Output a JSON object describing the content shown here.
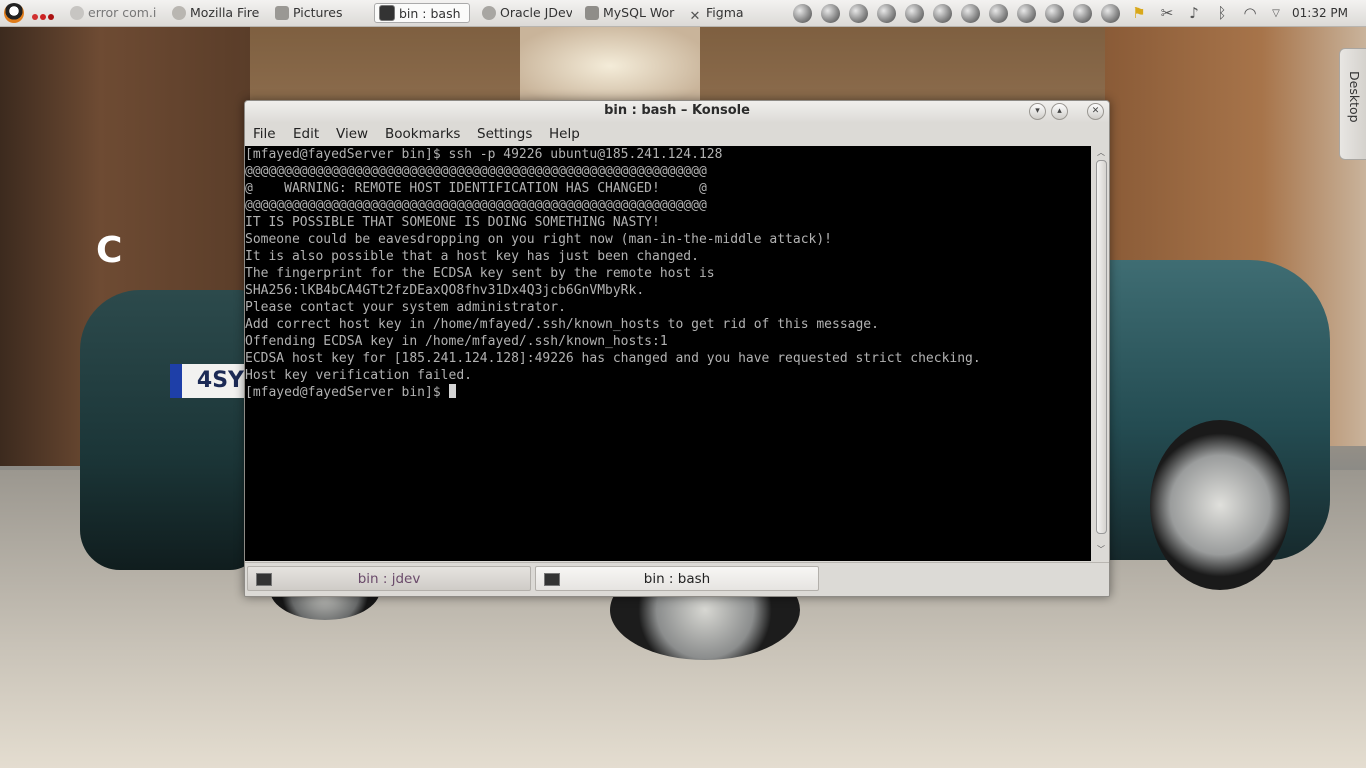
{
  "taskbar": {
    "tasks": [
      {
        "label": "error com.i"
      },
      {
        "label": "Mozilla Fire"
      },
      {
        "label": "Pictures"
      },
      {
        "label": "bin : bash"
      },
      {
        "label": "Oracle JDev"
      },
      {
        "label": "MySQL Wor"
      },
      {
        "label": "Figma"
      }
    ],
    "clock": "01:32 PM",
    "desktop_label": "Desktop"
  },
  "window": {
    "title": "bin : bash – Konsole",
    "menu": [
      "File",
      "Edit",
      "View",
      "Bookmarks",
      "Settings",
      "Help"
    ]
  },
  "terminal": {
    "lines": [
      "[mfayed@fayedServer bin]$ ssh -p 49226 ubuntu@185.241.124.128",
      "@@@@@@@@@@@@@@@@@@@@@@@@@@@@@@@@@@@@@@@@@@@@@@@@@@@@@@@@@@@",
      "@    WARNING: REMOTE HOST IDENTIFICATION HAS CHANGED!     @",
      "@@@@@@@@@@@@@@@@@@@@@@@@@@@@@@@@@@@@@@@@@@@@@@@@@@@@@@@@@@@",
      "IT IS POSSIBLE THAT SOMEONE IS DOING SOMETHING NASTY!",
      "Someone could be eavesdropping on you right now (man-in-the-middle attack)!",
      "It is also possible that a host key has just been changed.",
      "The fingerprint for the ECDSA key sent by the remote host is",
      "SHA256:lKB4bCA4GTt2fzDEaxQO8fhv31Dx4Q3jcb6GnVMbyRk.",
      "Please contact your system administrator.",
      "Add correct host key in /home/mfayed/.ssh/known_hosts to get rid of this message.",
      "Offending ECDSA key in /home/mfayed/.ssh/known_hosts:1",
      "ECDSA host key for [185.241.124.128]:49226 has changed and you have requested strict checking.",
      "Host key verification failed."
    ],
    "prompt": "[mfayed@fayedServer bin]$ "
  },
  "tabs": [
    {
      "label": "bin : jdev",
      "active": false
    },
    {
      "label": "bin : bash",
      "active": true
    }
  ],
  "wallpaper": {
    "plate_text": "4SY",
    "building_letter": "C"
  },
  "colors": {
    "terminal_bg": "#000000",
    "terminal_fg": "#b2b2b2",
    "chrome_bg": "#dcdad6",
    "inactive_tab_text": "#6a4a6a"
  }
}
